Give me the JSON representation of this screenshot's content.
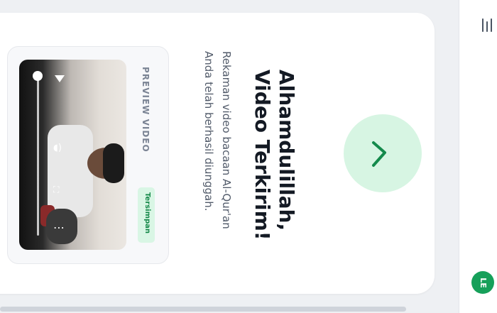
{
  "header": {
    "title_line1": "Alhamdulillah,",
    "title_line2": "Video Terkirim!",
    "subtitle_line1": "Rekaman video bacaan Al-Qur'an",
    "subtitle_line2": "Anda telah berhasil diunggah."
  },
  "preview": {
    "label": "PREVIEW VIDEO",
    "status_badge": "Tersimpan",
    "controls": {
      "play_icon": "play-icon",
      "volume_icon": "volume-icon",
      "fullscreen_icon": "fullscreen-icon",
      "more_icon": "more-options-icon"
    }
  },
  "rail": {
    "menu_icon": "menu-icon",
    "avatar_initials": "LE"
  },
  "colors": {
    "accent_green": "#16a05a",
    "check_bg": "#d7f5e3",
    "badge_bg": "#d9f6e5",
    "title_text": "#141a24"
  }
}
